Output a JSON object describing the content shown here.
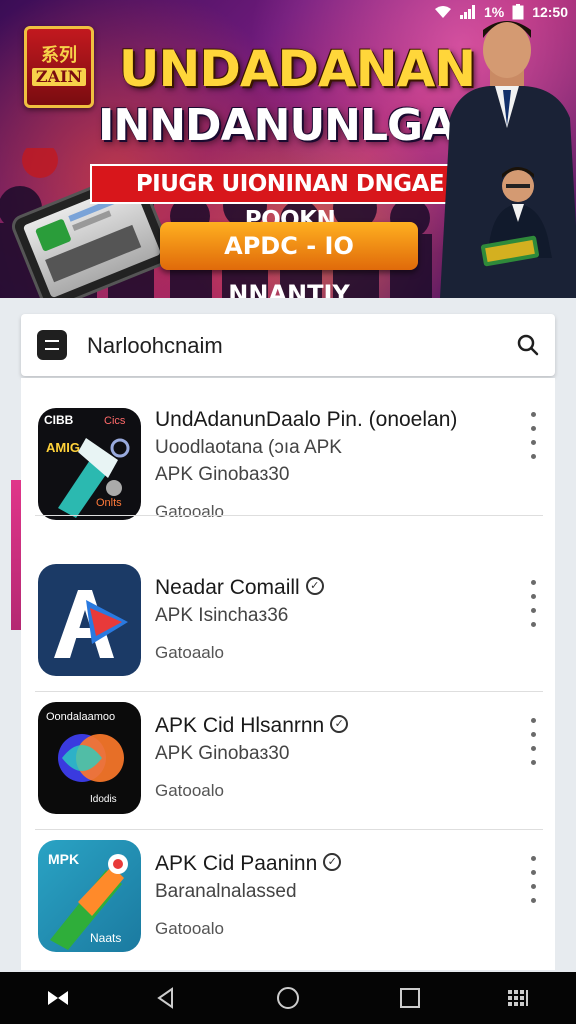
{
  "status_bar": {
    "battery": "1%",
    "time": "12:50"
  },
  "banner": {
    "logo_top": "系列",
    "logo_mid": "ZAIN",
    "logo_bottom": "",
    "headline_1": "UNDADANAN",
    "headline_2": "INNDANUNLGAII",
    "subtitle": "PIUGR UIONINAN DNGAE POOKN",
    "cta_label": "APDC - IO NNANTIY"
  },
  "search": {
    "text": "Narloohcnaim"
  },
  "apps": [
    {
      "title": "UndAdanunDaalo Pin. (onoelan)",
      "line2": "Uoodlaotana (ɔıa APK",
      "line3": "APK Ginobaɜ30",
      "meta": "Gatooalo",
      "verified": false,
      "icon_texts": [
        "CIBB",
        "Cics",
        "AMIG",
        "Onlts"
      ],
      "colors": {
        "bg": "#0e0e12",
        "accent": "#2bb9b0"
      }
    },
    {
      "title": "Neadar Comaill",
      "line2": "APK Isinchaз36",
      "line3": "",
      "meta": "Gatoaalo",
      "verified": true,
      "icon_texts": [],
      "colors": {
        "bg": "#1b3a66",
        "accent": "#2a7ae0"
      }
    },
    {
      "title": "APK Cid Hlsanrnn",
      "line2": "APK Ginobaɜ30",
      "line3": "",
      "meta": "Gatooalo",
      "verified": true,
      "icon_texts": [
        "Oondalaamoo",
        "Idodis"
      ],
      "colors": {
        "bg": "#0b0b0b",
        "accent": "#ff7a2a"
      }
    },
    {
      "title": "APK Cid Paaninn",
      "line2": "Baranalnalassed",
      "line3": "",
      "meta": "Gatooalo",
      "verified": true,
      "icon_texts": [
        "MPK",
        "Naats"
      ],
      "colors": {
        "bg": "#2aa3c4",
        "accent": "#ff8a2a"
      }
    }
  ]
}
